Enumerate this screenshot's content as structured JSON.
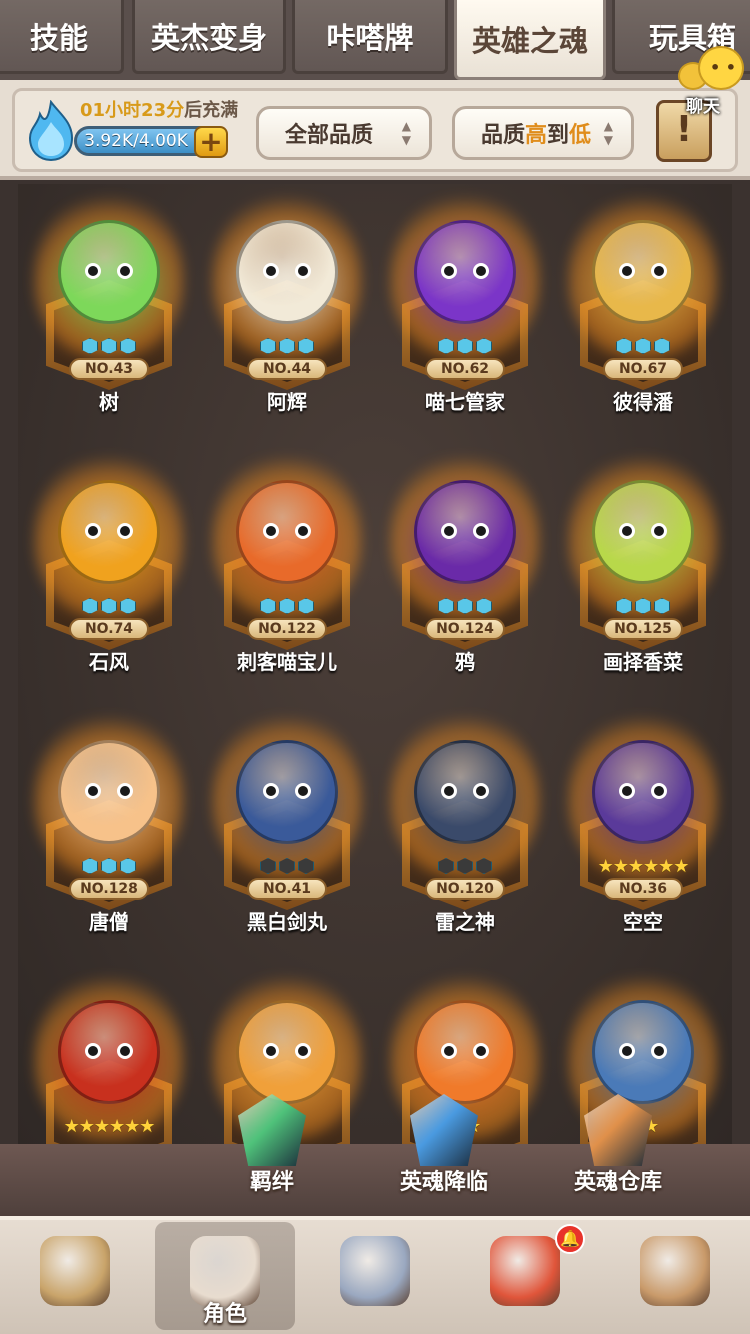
{
  "tabs": [
    {
      "label": "技能",
      "active": false
    },
    {
      "label": "英杰变身",
      "active": false
    },
    {
      "label": "咔嗒牌",
      "active": false
    },
    {
      "label": "英雄之魂",
      "active": true
    },
    {
      "label": "玩具箱",
      "active": false
    }
  ],
  "chat": {
    "label": "聊天"
  },
  "energy": {
    "timer_value": "01小时23分",
    "timer_suffix": "后充满",
    "value_text": "3.92K/4.00K",
    "fill_fraction": 0.98,
    "plus_label": "+"
  },
  "filters": {
    "quality": {
      "label": "全部品质"
    },
    "sort": {
      "prefix": "品质",
      "high": "高",
      "mid": "到",
      "low": "低"
    }
  },
  "heroes": [
    {
      "name": "树",
      "number": "NO.43",
      "rank": "gems",
      "gems": 3,
      "color": "#7dd85a"
    },
    {
      "name": "阿辉",
      "number": "NO.44",
      "rank": "gems",
      "gems": 3,
      "color": "#f2ead8"
    },
    {
      "name": "喵七管家",
      "number": "NO.62",
      "rank": "gems",
      "gems": 3,
      "color": "#7b35c8"
    },
    {
      "name": "彼得潘",
      "number": "NO.67",
      "rank": "gems",
      "gems": 3,
      "color": "#e8b84a"
    },
    {
      "name": "石风",
      "number": "NO.74",
      "rank": "gems",
      "gems": 3,
      "color": "#f0a21e"
    },
    {
      "name": "刺客喵宝儿",
      "number": "NO.122",
      "rank": "gems",
      "gems": 3,
      "color": "#e86a2a"
    },
    {
      "name": "鸦",
      "number": "NO.124",
      "rank": "gems",
      "gems": 3,
      "color": "#6a2aa8"
    },
    {
      "name": "画择香菜",
      "number": "NO.125",
      "rank": "gems",
      "gems": 3,
      "color": "#b8d84a"
    },
    {
      "name": "唐僧",
      "number": "NO.128",
      "rank": "gems",
      "gems": 3,
      "color": "#f7c28a"
    },
    {
      "name": "黑白剑丸",
      "number": "NO.41",
      "rank": "gems",
      "gems": 3,
      "color": "#3a5a9a",
      "dark": true
    },
    {
      "name": "雷之神",
      "number": "NO.120",
      "rank": "gems",
      "gems": 3,
      "color": "#3a4a6a",
      "dark": true
    },
    {
      "name": "空空",
      "number": "NO.36",
      "rank": "stars",
      "stars": "★★★★★★",
      "color": "#5a3a9a"
    },
    {
      "name": "",
      "number": "",
      "rank": "stars",
      "stars": "★★★★★★",
      "color": "#c8301e"
    },
    {
      "name": "",
      "number": "",
      "rank": "stars",
      "stars": "★★",
      "color": "#f0a03a"
    },
    {
      "name": "",
      "number": "",
      "rank": "stars",
      "stars": "★★",
      "color": "#f07a2a"
    },
    {
      "name": "",
      "number": "",
      "rank": "stars",
      "stars": "★★",
      "color": "#4a7ab8"
    }
  ],
  "actions": [
    {
      "label": "羁绊",
      "icon": "green-crystal-icon",
      "color": "#4fc27a"
    },
    {
      "label": "英魂降临",
      "icon": "blue-crystal-icon",
      "color": "#4a9ae0"
    },
    {
      "label": "英魂仓库",
      "icon": "orange-crystal-icon",
      "color": "#e0904a"
    }
  ],
  "nav": [
    {
      "label": "",
      "icon": "nest-icon",
      "color": "#c9a46a",
      "active": false
    },
    {
      "label": "角色",
      "icon": "hero-avatar-icon",
      "color": "#e8dccf",
      "active": true
    },
    {
      "label": "",
      "icon": "sword-icon",
      "color": "#9aa8c0",
      "active": false
    },
    {
      "label": "",
      "icon": "dino-icon",
      "color": "#e0553a",
      "active": false,
      "badge": "🔔"
    },
    {
      "label": "",
      "icon": "totem-icon",
      "color": "#c99a6a",
      "active": false
    }
  ]
}
